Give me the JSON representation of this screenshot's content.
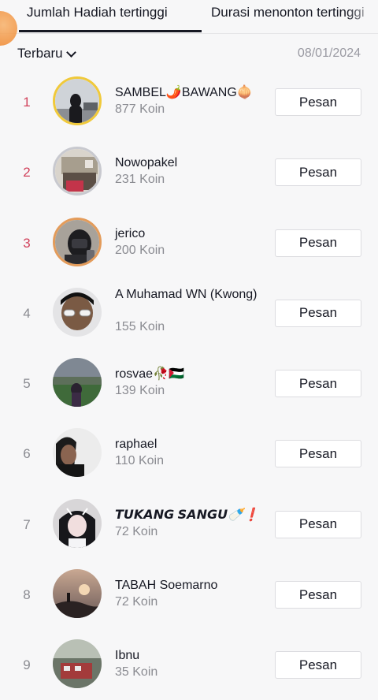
{
  "tabs": [
    {
      "label": "Jumlah Hadiah tertinggi",
      "active": true
    },
    {
      "label": "Durasi menonton tertinggi",
      "active": false
    }
  ],
  "filter": {
    "sort_label": "Terbaru",
    "date": "08/01/2024"
  },
  "message_label": "Pesan",
  "colors": {
    "top_rank": "#d1415b",
    "rank": "#8a8b91",
    "gold": "#f0c93a",
    "silver": "#c8c9cf",
    "bronze": "#e39b5a"
  },
  "viewers": [
    {
      "rank": "1",
      "name": "SAMBEL🌶️BAWANG🧅",
      "coins": "877 Koin"
    },
    {
      "rank": "2",
      "name": "Nowopakel",
      "coins": "231 Koin"
    },
    {
      "rank": "3",
      "name": "jerico",
      "coins": "200 Koin"
    },
    {
      "rank": "4",
      "name": "A Muhamad WN (Kwong)",
      "coins": "155 Koin"
    },
    {
      "rank": "5",
      "name": "rosvae🥀🇵🇸",
      "coins": "139 Koin"
    },
    {
      "rank": "6",
      "name": "raphael",
      "coins": "110 Koin"
    },
    {
      "rank": "7",
      "name": "𝙏𝙐𝙆𝘼𝙉𝙂 𝙎𝘼𝙉𝙂𝙐🍼❗",
      "coins": "72 Koin"
    },
    {
      "rank": "8",
      "name": "TABAH Soemarno",
      "coins": "72 Koin"
    },
    {
      "rank": "9",
      "name": "Ibnu",
      "coins": "35 Koin"
    }
  ]
}
